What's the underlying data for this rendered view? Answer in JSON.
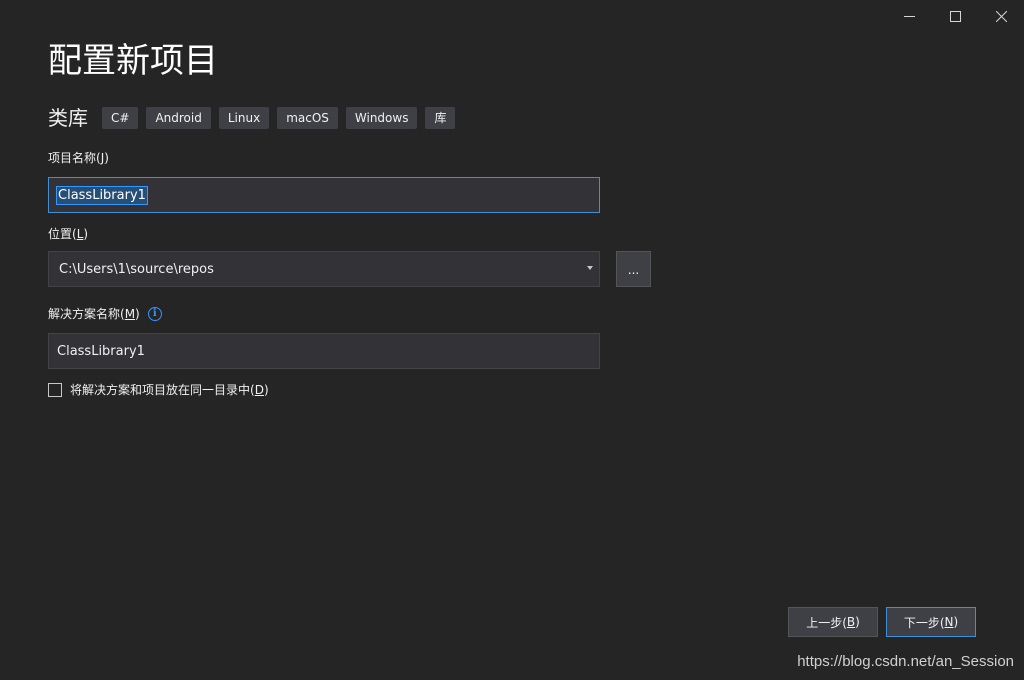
{
  "window": {
    "controls": {
      "minimize_icon": "minimize-icon",
      "maximize_icon": "maximize-icon",
      "close_icon": "close-icon"
    }
  },
  "page": {
    "title": "配置新项目"
  },
  "template": {
    "name": "类库",
    "tags": [
      "C#",
      "Android",
      "Linux",
      "macOS",
      "Windows",
      "库"
    ]
  },
  "project_name": {
    "label": "项目名称(",
    "mnemonic": "J",
    "label_end": ")",
    "value": "ClassLibrary1"
  },
  "location": {
    "label": "位置(",
    "mnemonic": "L",
    "label_end": ")",
    "value": "C:\\Users\\1\\source\\repos",
    "browse_label": "..."
  },
  "solution_name": {
    "label": "解决方案名称(",
    "mnemonic": "M",
    "label_end": ")",
    "info_icon": "info-icon",
    "value": "ClassLibrary1"
  },
  "same_directory": {
    "label": "将解决方案和项目放在同一目录中(",
    "mnemonic": "D",
    "label_end": ")",
    "checked": false
  },
  "footer": {
    "back_label": "上一步(",
    "back_mnemonic": "B",
    "back_end": ")",
    "next_label": "下一步(",
    "next_mnemonic": "N",
    "next_end": ")"
  },
  "watermark": "https://blog.csdn.net/an_Session",
  "colors": {
    "background": "#252526",
    "input_background": "#333337",
    "focus_border": "#3e8fd6",
    "info_accent": "#3794ff",
    "tag_background": "#3f3f46"
  }
}
